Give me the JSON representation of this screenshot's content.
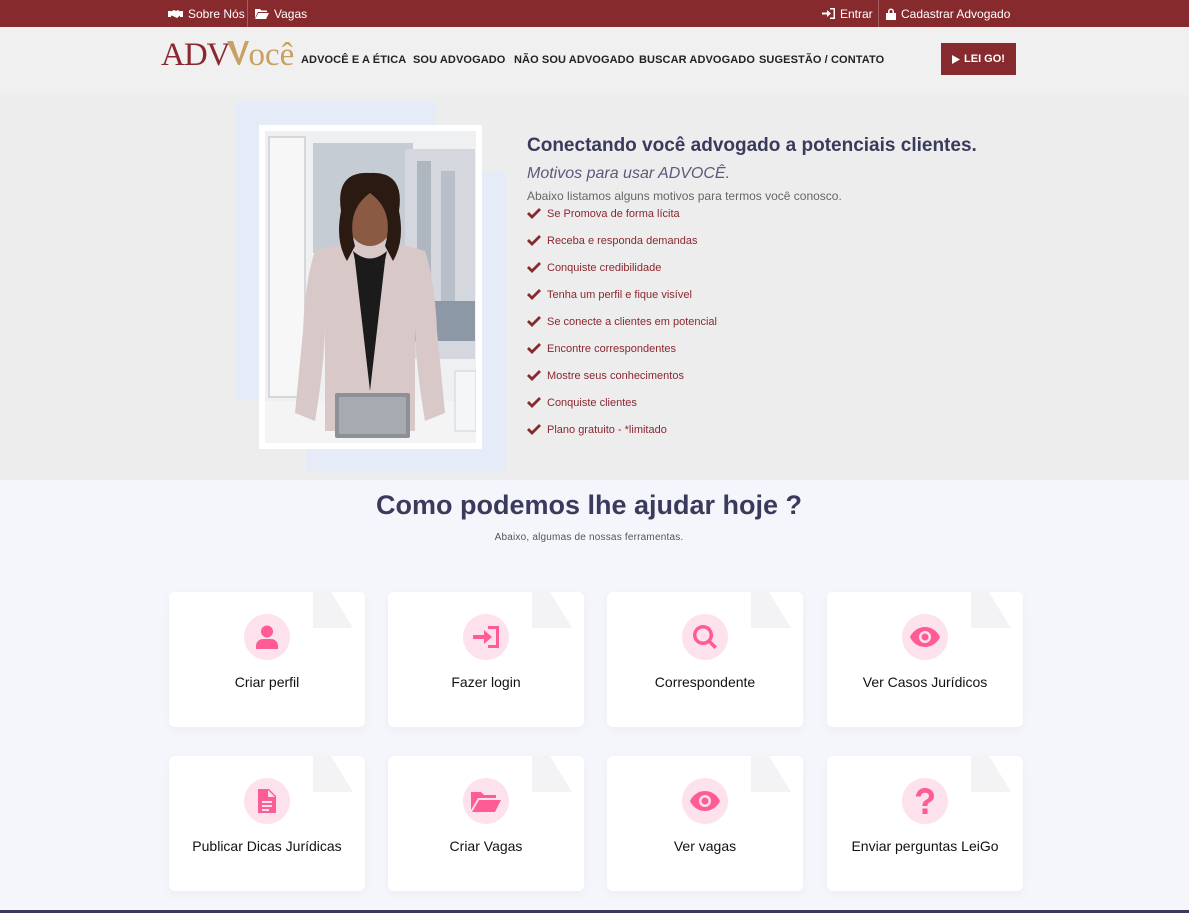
{
  "topbar": {
    "sobre": "Sobre Nós",
    "vagas": "Vagas",
    "entrar": "Entrar",
    "cadastrar": "Cadastrar Advogado"
  },
  "nav": {
    "logo_adv": "ADV",
    "logo_voce": "ocê",
    "links": [
      "ADVOCÊ E A ÉTICA",
      "SOU ADVOGADO",
      "NÃO SOU ADVOGADO",
      "BUSCAR ADVOGADO",
      "SUGESTÃO / CONTATO"
    ],
    "leigo": "LEI GO!"
  },
  "hero": {
    "title": "Conectando você advogado a potenciais clientes.",
    "subtitle": "Motivos para usar ADVOCÊ.",
    "description": "Abaixo listamos alguns motivos para termos você conosco.",
    "reasons": [
      "Se Promova de forma lícita",
      "Receba e responda demandas",
      "Conquiste credibilidade",
      "Tenha um perfil e fique visível",
      "Se conecte a clientes em potencial",
      "Encontre correspondentes",
      "Mostre seus conhecimentos",
      "Conquiste clientes",
      "Plano gratuito - *limitado"
    ]
  },
  "help": {
    "title": "Como podemos lhe ajudar hoje ?",
    "subtitle": "Abaixo, algumas de nossas ferramentas.",
    "cards": [
      {
        "label": "Criar perfil",
        "icon": "user-icon"
      },
      {
        "label": "Fazer login",
        "icon": "login-icon"
      },
      {
        "label": "Correspondente",
        "icon": "search-icon"
      },
      {
        "label": "Ver Casos Jurídicos",
        "icon": "eye-icon"
      },
      {
        "label": "Publicar Dicas Jurídicas",
        "icon": "document-icon"
      },
      {
        "label": "Criar Vagas",
        "icon": "folder-open-icon"
      },
      {
        "label": "Ver vagas",
        "icon": "eye-icon"
      },
      {
        "label": "Enviar perguntas LeiGo",
        "icon": "question-icon"
      }
    ]
  },
  "colors": {
    "brand": "#862a2e",
    "gold": "#c9a063",
    "heading": "#3a3b5c",
    "icon_pink": "#ff5b95",
    "icon_bg": "#fde1ec"
  }
}
